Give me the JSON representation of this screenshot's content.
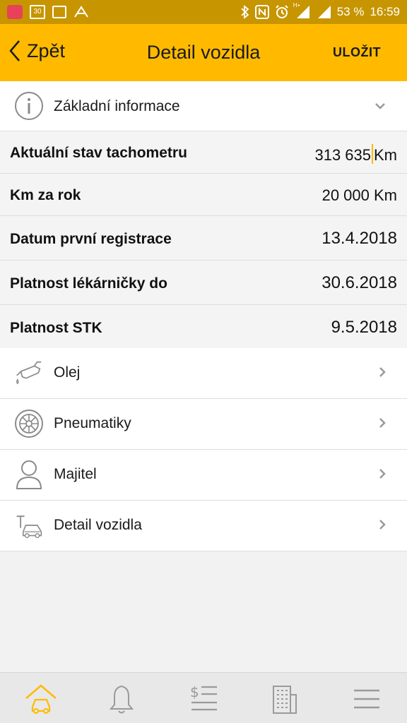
{
  "status_bar": {
    "calendar_day": "30",
    "network": "H+",
    "battery": "53 %",
    "time": "16:59"
  },
  "app_bar": {
    "back_label": "Zpět",
    "title": "Detail vozidla",
    "save_label": "ULOŽIT"
  },
  "section": {
    "label": "Základní informace",
    "icon": "info-icon"
  },
  "fields": [
    {
      "label": "Aktuální stav tachometru",
      "value": "313 635",
      "unit": "Km",
      "focused": true
    },
    {
      "label": "Km za rok",
      "value": "20 000 Km"
    },
    {
      "label": "Datum první registrace",
      "value": "13.4.2018"
    },
    {
      "label": "Platnost lékárničky do",
      "value": "30.6.2018"
    },
    {
      "label": "Platnost STK",
      "value": "9.5.2018"
    }
  ],
  "nav_items": [
    {
      "label": "Olej",
      "icon": "oil-can-icon"
    },
    {
      "label": "Pneumatiky",
      "icon": "tire-icon"
    },
    {
      "label": "Majitel",
      "icon": "person-icon"
    },
    {
      "label": "Detail vozidla",
      "icon": "car-wrench-icon"
    }
  ],
  "bottom_tabs": [
    {
      "icon": "home-car-icon",
      "active": true
    },
    {
      "icon": "bell-icon"
    },
    {
      "icon": "cost-list-icon"
    },
    {
      "icon": "building-icon"
    },
    {
      "icon": "menu-icon"
    }
  ],
  "colors": {
    "accent": "#ffba00",
    "status_bar": "#c79500",
    "icon_gray": "#9a9a9a"
  }
}
